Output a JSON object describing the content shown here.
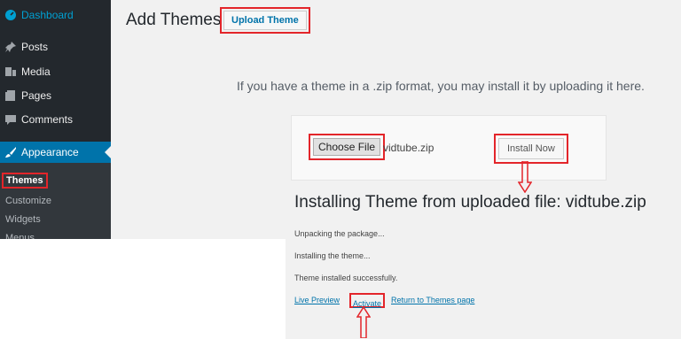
{
  "sidebar": {
    "items": [
      {
        "label": "Dashboard",
        "icon": "dashboard-icon"
      },
      {
        "label": "Posts",
        "icon": "pushpin-icon"
      },
      {
        "label": "Media",
        "icon": "media-icon"
      },
      {
        "label": "Pages",
        "icon": "pages-icon"
      },
      {
        "label": "Comments",
        "icon": "comment-icon"
      },
      {
        "label": "Appearance",
        "icon": "paintbrush-icon",
        "active": true
      }
    ],
    "submenu": [
      "Themes",
      "Customize",
      "Widgets",
      "Menus"
    ]
  },
  "header": {
    "title": "Add Themes",
    "upload_button": "Upload Theme"
  },
  "upload": {
    "instructions": "If you have a theme in a .zip format, you may install it by uploading it here.",
    "choose_file": "Choose File",
    "file_name": "vidtube.zip",
    "install_button": "Install Now"
  },
  "result": {
    "title": "Installing Theme from uploaded file: vidtube.zip",
    "log": [
      "Unpacking the package...",
      "Installing the theme...",
      "Theme installed successfully."
    ],
    "links": {
      "live_preview": "Live Preview",
      "activate": "Activate",
      "return": "Return to Themes page"
    }
  },
  "colors": {
    "sidebar_bg": "#23282d",
    "active_menu": "#0073aa",
    "highlight": "#e3252a",
    "link": "#0073aa"
  }
}
